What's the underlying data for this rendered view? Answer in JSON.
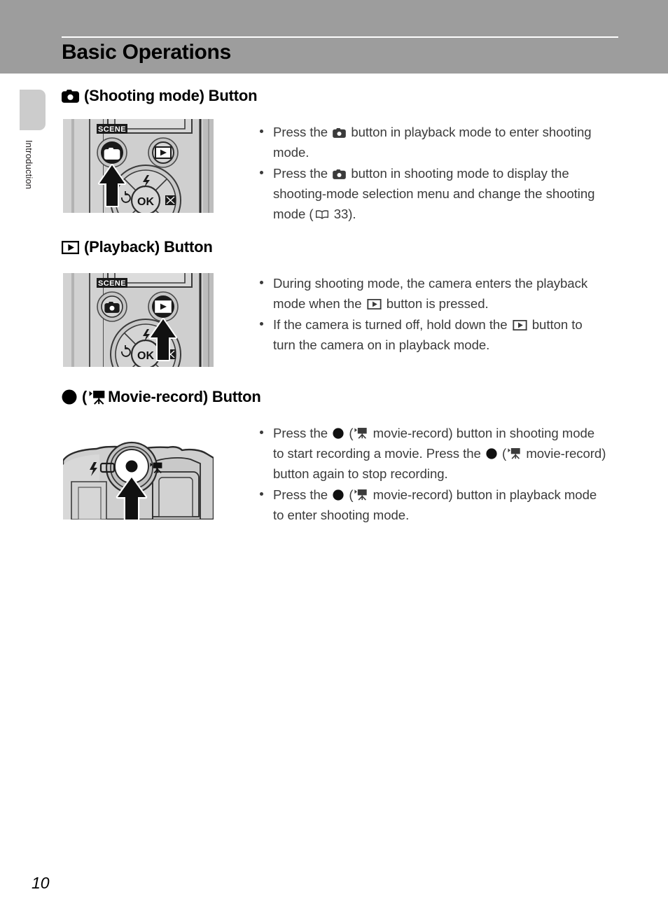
{
  "page": {
    "header_title": "Basic Operations",
    "side_tab_label": "Introduction",
    "page_number": "10",
    "band_color": "#9d9d9d",
    "tab_color": "#cccccc",
    "body_text_color": "#3b3b3b",
    "illustration_bg": "#d2d2d2"
  },
  "sections": [
    {
      "heading": {
        "icon": "camera-icon",
        "text": "(Shooting mode) Button"
      },
      "illustration": {
        "name": "camera-back-shooting-mode-illustration",
        "labels": [
          "SCENE",
          "OK"
        ],
        "highlight": "shooting-mode-button"
      },
      "bullets": [
        {
          "parts": [
            {
              "t": "text",
              "v": "Press the "
            },
            {
              "t": "icon",
              "v": "camera-icon"
            },
            {
              "t": "text",
              "v": " button in playback mode to enter shooting mode."
            }
          ]
        },
        {
          "parts": [
            {
              "t": "text",
              "v": "Press the "
            },
            {
              "t": "icon",
              "v": "camera-icon"
            },
            {
              "t": "text",
              "v": " button in shooting mode to display the shooting-mode selection menu and change the shooting mode ("
            },
            {
              "t": "icon",
              "v": "book-icon"
            },
            {
              "t": "text",
              "v": " 33)."
            }
          ]
        }
      ]
    },
    {
      "heading": {
        "icon": "playback-icon",
        "text": "(Playback) Button"
      },
      "illustration": {
        "name": "camera-back-playback-illustration",
        "labels": [
          "SCENE",
          "OK"
        ],
        "highlight": "playback-button"
      },
      "bullets": [
        {
          "parts": [
            {
              "t": "text",
              "v": "During shooting mode, the camera enters the playback mode when the "
            },
            {
              "t": "icon",
              "v": "playback-icon"
            },
            {
              "t": "text",
              "v": " button is pressed."
            }
          ]
        },
        {
          "parts": [
            {
              "t": "text",
              "v": "If the camera is turned off, hold down the "
            },
            {
              "t": "icon",
              "v": "playback-icon"
            },
            {
              "t": "text",
              "v": " button to turn the camera on in playback mode."
            }
          ]
        }
      ]
    },
    {
      "heading": {
        "icon": "record-dot-icon",
        "icon2": "movie-camera-icon",
        "text_open": "(",
        "text": " Movie-record) Button"
      },
      "illustration": {
        "name": "camera-top-movie-record-illustration",
        "labels": [],
        "highlight": "movie-record-button"
      },
      "bullets": [
        {
          "parts": [
            {
              "t": "text",
              "v": "Press the "
            },
            {
              "t": "icon",
              "v": "record-dot-icon"
            },
            {
              "t": "text",
              "v": " ("
            },
            {
              "t": "icon",
              "v": "movie-camera-icon"
            },
            {
              "t": "text",
              "v": " movie-record) button in shooting mode to start recording a movie. Press the "
            },
            {
              "t": "icon",
              "v": "record-dot-icon"
            },
            {
              "t": "text",
              "v": " ("
            },
            {
              "t": "icon",
              "v": "movie-camera-icon"
            },
            {
              "t": "text",
              "v": " movie-record) button again to stop recording."
            }
          ]
        },
        {
          "parts": [
            {
              "t": "text",
              "v": "Press the "
            },
            {
              "t": "icon",
              "v": "record-dot-icon"
            },
            {
              "t": "text",
              "v": " ("
            },
            {
              "t": "icon",
              "v": "movie-camera-icon"
            },
            {
              "t": "text",
              "v": " movie-record) button in playback mode to enter shooting mode."
            }
          ]
        }
      ]
    }
  ]
}
